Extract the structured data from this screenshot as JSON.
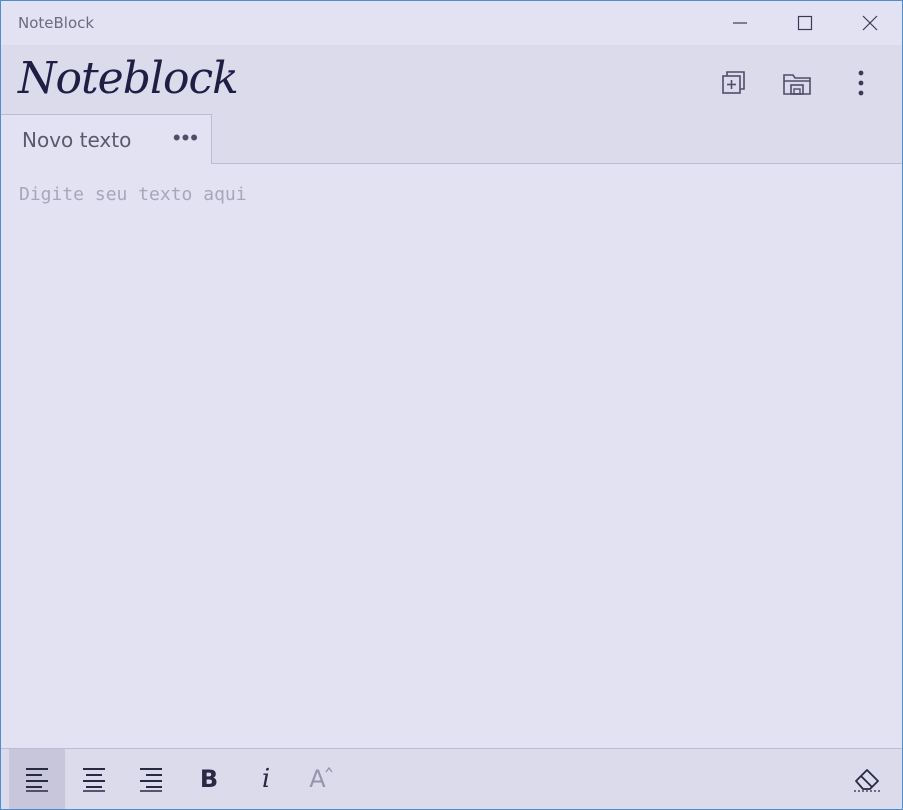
{
  "window": {
    "title": "NoteBlock"
  },
  "header": {
    "logo_text": "Noteblock"
  },
  "tabs": [
    {
      "label": "Novo texto",
      "menu_glyph": "•••"
    }
  ],
  "editor": {
    "placeholder": "Digite seu texto aqui",
    "value": ""
  },
  "toolbar": {
    "bold_label": "B",
    "italic_label": "i",
    "font_size_label": "A"
  },
  "icons": {
    "minimize": "minimize-icon",
    "maximize": "maximize-icon",
    "close": "close-icon",
    "new_tab": "new-tab-icon",
    "open_folder": "folder-icon",
    "more": "more-vertical-icon",
    "align_left": "align-left-icon",
    "align_center": "align-center-icon",
    "align_right": "align-right-icon",
    "eraser": "eraser-icon"
  },
  "colors": {
    "background": "#e3e2f3",
    "header": "#dcdbec",
    "accent_text": "#1f1e45",
    "border": "#bdbcd6"
  }
}
